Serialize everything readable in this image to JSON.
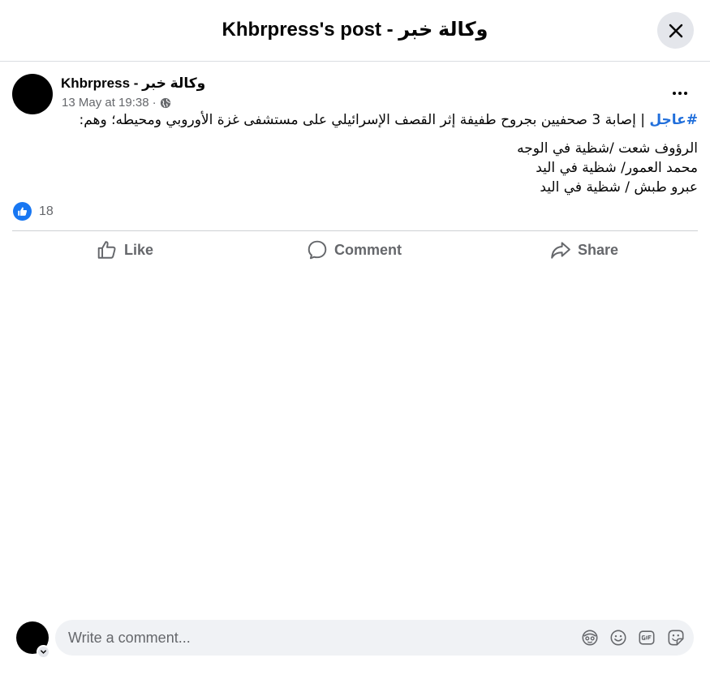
{
  "header": {
    "title": "Khbrpress's post - وكالة خبر"
  },
  "post": {
    "author": "Khbrpress - وكالة خبر",
    "timestamp": "13 May at 19:38",
    "separator": "·",
    "audience_icon": "globe-icon",
    "hashtag": "#عاجل",
    "headline": " | إصابة 3 صحفيين بجروح طفيفة إثر القصف الإسرائيلي على مستشفى غزة الأوروبي ومحيطه؛ وهم:",
    "lines": [
      "الرؤوف شعت /شظية في الوجه",
      "محمد العمور/ شظية في اليد",
      "عبرو طبش / شظية في اليد"
    ],
    "reaction_count": "18"
  },
  "actions": {
    "like_label": "Like",
    "comment_label": "Comment",
    "share_label": "Share"
  },
  "comment_box": {
    "placeholder": "Write a comment...",
    "icons": [
      "avatar-sticker-icon",
      "emoji-icon",
      "gif-icon",
      "sticker-icon"
    ]
  },
  "colors": {
    "accent": "#1877f2",
    "hashtag": "#216fdb",
    "secondary_text": "#65676b",
    "input_bg": "#f0f2f5"
  }
}
